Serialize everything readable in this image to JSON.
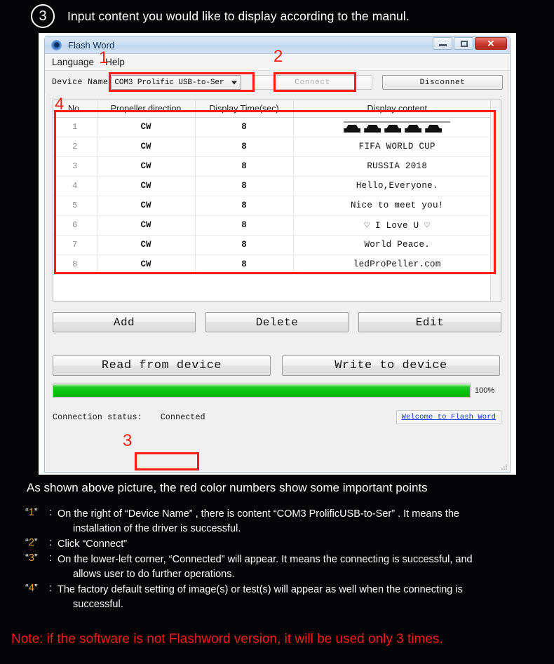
{
  "step": {
    "number": "3",
    "text": "Input content you would like to display according to the manul."
  },
  "window": {
    "title": "Flash Word",
    "controls": {
      "minimize": "–",
      "maximize": "□",
      "close": "✕"
    },
    "menu": [
      "Language",
      "Help"
    ],
    "device": {
      "label": "Device Name",
      "selected": "COM3 Prolific USB-to-Ser",
      "connect_label": "Connect",
      "disconnect_label": "Disconnet"
    },
    "table": {
      "headers": [
        "No.",
        "Propeller direction",
        "Display Time(sec)",
        "Display content"
      ],
      "rows": [
        {
          "no": "1",
          "direction": "CW",
          "time": "8",
          "content": "",
          "is_graphic": true
        },
        {
          "no": "2",
          "direction": "CW",
          "time": "8",
          "content": "FIFA WORLD CUP",
          "is_graphic": false
        },
        {
          "no": "3",
          "direction": "CW",
          "time": "8",
          "content": "RUSSIA 2018",
          "is_graphic": false
        },
        {
          "no": "4",
          "direction": "CW",
          "time": "8",
          "content": "Hello,Everyone.",
          "is_graphic": false
        },
        {
          "no": "5",
          "direction": "CW",
          "time": "8",
          "content": "Nice to meet you!",
          "is_graphic": false
        },
        {
          "no": "6",
          "direction": "CW",
          "time": "8",
          "content": "♡ I Love U ♡",
          "is_graphic": false
        },
        {
          "no": "7",
          "direction": "CW",
          "time": "8",
          "content": "World Peace.",
          "is_graphic": false
        },
        {
          "no": "8",
          "direction": "CW",
          "time": "8",
          "content": "ledProPeller.com",
          "is_graphic": false
        }
      ]
    },
    "buttons": {
      "add": "Add",
      "delete": "Delete",
      "edit": "Edit",
      "read": "Read from device",
      "write": "Write to device"
    },
    "progress": {
      "percent": "100%",
      "value": 100
    },
    "status": {
      "label": "Connection status:",
      "value": "Connected",
      "link": "Welcome to Flash Word"
    }
  },
  "annotations": {
    "one": "1",
    "two": "2",
    "three": "3",
    "four": "4"
  },
  "caption": "As shown above picture, the red color numbers show some important points",
  "bullets": [
    {
      "num": "1",
      "line1": "On the right of  “Device Name” , there is content  “COM3 ProlificUSB-to-Ser” . It means the",
      "line2": "installation of the driver is successful."
    },
    {
      "num": "2",
      "line1": "Click  “Connect”",
      "line2": ""
    },
    {
      "num": "3",
      "line1": "On the lower-left corner,  “Connected”  will appear. It means the connecting is successful, and",
      "line2": "allows user to do further operations."
    },
    {
      "num": "4",
      "line1": "The factory default setting of image(s) or test(s) will appear as well when the connecting is",
      "line2": "successful."
    }
  ],
  "note": "Note: if the software is not Flashword version, it will be used only 3 times.",
  "colors": {
    "accent_red": "#fc1c13",
    "note_red": "#ef1c1c",
    "bullet_number": "#e8a33d",
    "progress_green": "#06c008",
    "link_blue": "#1436d6"
  }
}
